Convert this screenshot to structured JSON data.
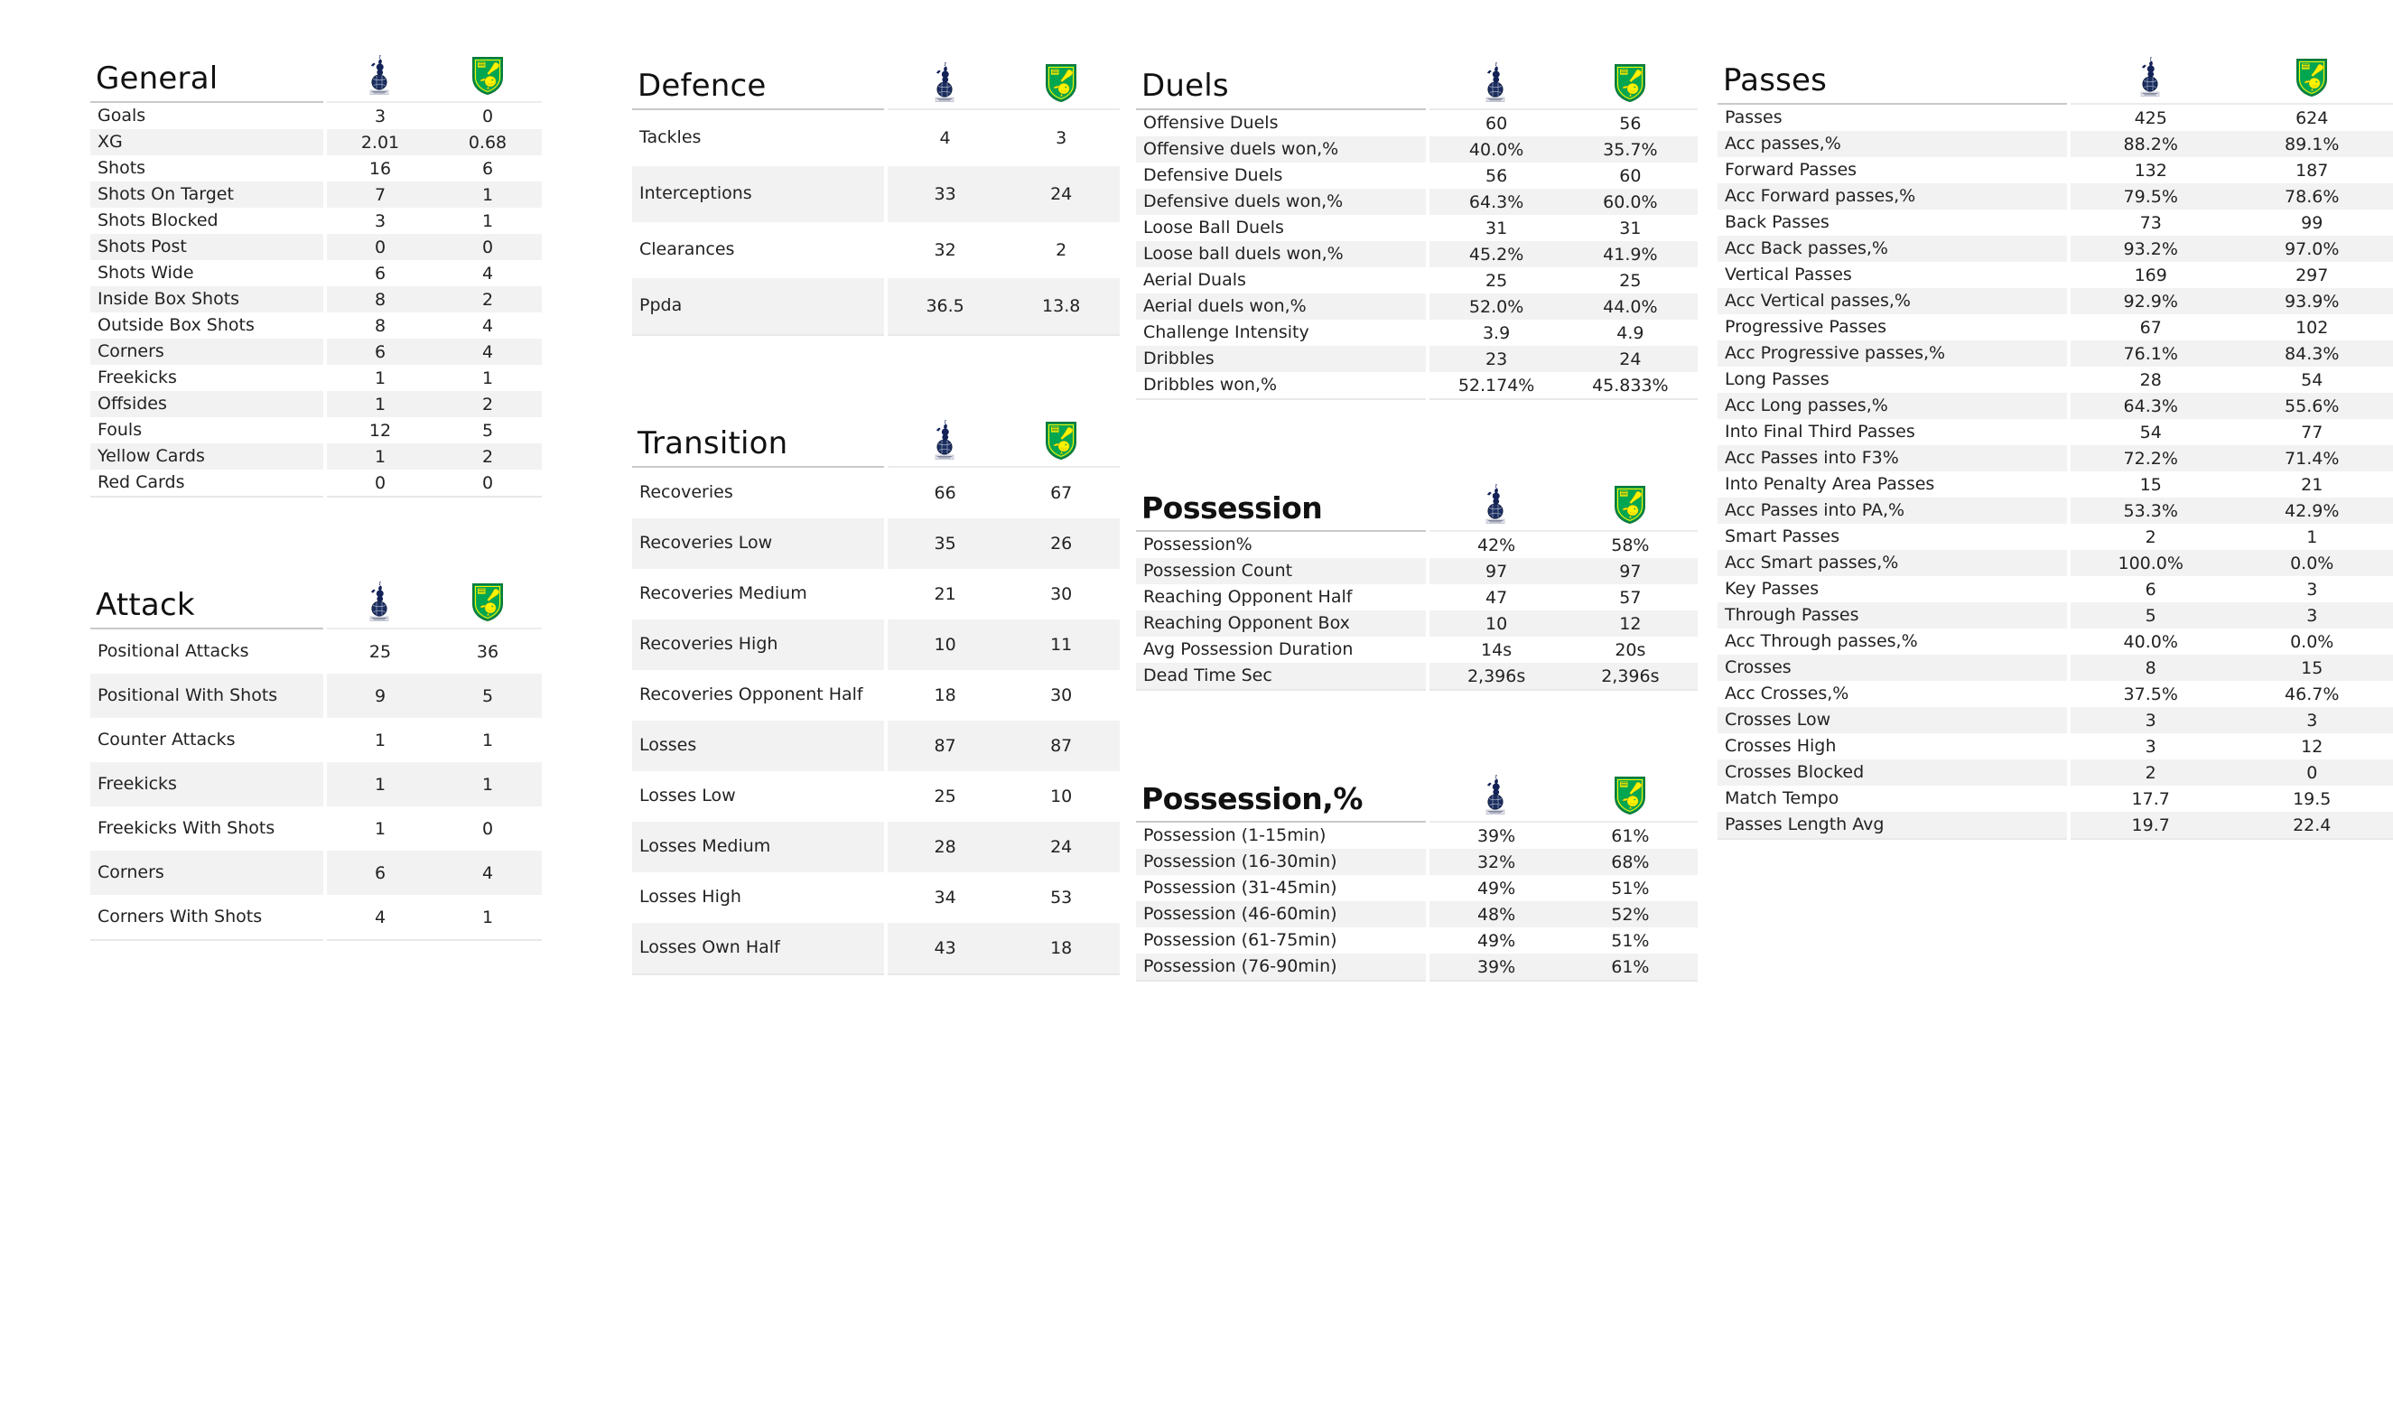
{
  "teams": {
    "home": {
      "name": "Tottenham Hotspur",
      "logo": "tottenham-crest-icon",
      "colors": {
        "primary": "#132257",
        "secondary": "#ffffff"
      }
    },
    "away": {
      "name": "Norwich City",
      "logo": "norwich-city-crest-icon",
      "colors": {
        "primary": "#00a650",
        "secondary": "#fff200"
      }
    }
  },
  "sections": [
    {
      "id": "general",
      "title": "General",
      "title_style": "regular",
      "row_height": "h-sm",
      "rows": [
        {
          "label": "Goals",
          "home": "3",
          "away": "0"
        },
        {
          "label": "XG",
          "home": "2.01",
          "away": "0.68"
        },
        {
          "label": "Shots",
          "home": "16",
          "away": "6"
        },
        {
          "label": "Shots On Target",
          "home": "7",
          "away": "1"
        },
        {
          "label": "Shots Blocked",
          "home": "3",
          "away": "1"
        },
        {
          "label": "Shots Post",
          "home": "0",
          "away": "0"
        },
        {
          "label": "Shots Wide",
          "home": "6",
          "away": "4"
        },
        {
          "label": "Inside Box Shots",
          "home": "8",
          "away": "2"
        },
        {
          "label": "Outside Box Shots",
          "home": "8",
          "away": "4"
        },
        {
          "label": "Corners",
          "home": "6",
          "away": "4"
        },
        {
          "label": "Freekicks",
          "home": "1",
          "away": "1"
        },
        {
          "label": "Offsides",
          "home": "1",
          "away": "2"
        },
        {
          "label": "Fouls",
          "home": "12",
          "away": "5"
        },
        {
          "label": "Yellow Cards",
          "home": "1",
          "away": "2"
        },
        {
          "label": "Red Cards",
          "home": "0",
          "away": "0"
        }
      ]
    },
    {
      "id": "attack",
      "title": "Attack",
      "title_style": "regular",
      "row_height": "h-md",
      "rows": [
        {
          "label": "Positional Attacks",
          "home": "25",
          "away": "36"
        },
        {
          "label": "Positional With Shots",
          "home": "9",
          "away": "5"
        },
        {
          "label": "Counter Attacks",
          "home": "1",
          "away": "1"
        },
        {
          "label": "Freekicks",
          "home": "1",
          "away": "1"
        },
        {
          "label": "Freekicks With Shots",
          "home": "1",
          "away": "0"
        },
        {
          "label": "Corners",
          "home": "6",
          "away": "4"
        },
        {
          "label": "Corners With Shots",
          "home": "4",
          "away": "1"
        }
      ]
    },
    {
      "id": "defence",
      "title": "Defence",
      "title_style": "regular",
      "row_height": "h-xl",
      "rows": [
        {
          "label": "Tackles",
          "home": "4",
          "away": "3"
        },
        {
          "label": "Interceptions",
          "home": "33",
          "away": "24"
        },
        {
          "label": "Clearances",
          "home": "32",
          "away": "2"
        },
        {
          "label": "Ppda",
          "home": "36.5",
          "away": "13.8"
        }
      ]
    },
    {
      "id": "transition",
      "title": "Transition",
      "title_style": "regular",
      "row_height": "h-lg",
      "rows": [
        {
          "label": "Recoveries",
          "home": "66",
          "away": "67"
        },
        {
          "label": "Recoveries Low",
          "home": "35",
          "away": "26"
        },
        {
          "label": "Recoveries Medium",
          "home": "21",
          "away": "30"
        },
        {
          "label": "Recoveries High",
          "home": "10",
          "away": "11"
        },
        {
          "label": "Recoveries Opponent Half",
          "home": "18",
          "away": "30"
        },
        {
          "label": "Losses",
          "home": "87",
          "away": "87"
        },
        {
          "label": "Losses Low",
          "home": "25",
          "away": "10"
        },
        {
          "label": "Losses Medium",
          "home": "28",
          "away": "24"
        },
        {
          "label": "Losses High",
          "home": "34",
          "away": "53"
        },
        {
          "label": "Losses Own Half",
          "home": "43",
          "away": "18"
        }
      ]
    },
    {
      "id": "duels",
      "title": "Duels",
      "title_style": "regular",
      "row_height": "h-sm",
      "rows": [
        {
          "label": "Offensive Duels",
          "home": "60",
          "away": "56"
        },
        {
          "label": "Offensive duels won,%",
          "home": "40.0%",
          "away": "35.7%"
        },
        {
          "label": "Defensive Duels",
          "home": "56",
          "away": "60"
        },
        {
          "label": "Defensive duels won,%",
          "home": "64.3%",
          "away": "60.0%"
        },
        {
          "label": "Loose Ball Duels",
          "home": "31",
          "away": "31"
        },
        {
          "label": "Loose ball duels won,%",
          "home": "45.2%",
          "away": "41.9%"
        },
        {
          "label": "Aerial Duals",
          "home": "25",
          "away": "25"
        },
        {
          "label": "Aerial duels won,%",
          "home": "52.0%",
          "away": "44.0%"
        },
        {
          "label": "Challenge Intensity",
          "home": "3.9",
          "away": "4.9"
        },
        {
          "label": "Dribbles",
          "home": "23",
          "away": "24"
        },
        {
          "label": "Dribbles won,%",
          "home": "52.174%",
          "away": "45.833%"
        }
      ]
    },
    {
      "id": "possession",
      "title": "Possession",
      "title_style": "bold",
      "row_height": "h-sm",
      "rows": [
        {
          "label": "Possession%",
          "home": "42%",
          "away": "58%"
        },
        {
          "label": "Possession Count",
          "home": "97",
          "away": "97"
        },
        {
          "label": "Reaching Opponent Half",
          "home": "47",
          "away": "57"
        },
        {
          "label": "Reaching Opponent Box",
          "home": "10",
          "away": "12"
        },
        {
          "label": "Avg Possession Duration",
          "home": "14s",
          "away": "20s"
        },
        {
          "label": "Dead Time Sec",
          "home": "2,396s",
          "away": "2,396s"
        }
      ]
    },
    {
      "id": "possession-pct",
      "title": "Possession,%",
      "title_style": "bold",
      "row_height": "h-sm",
      "rows": [
        {
          "label": "Possession (1-15min)",
          "home": "39%",
          "away": "61%"
        },
        {
          "label": "Possession (16-30min)",
          "home": "32%",
          "away": "68%"
        },
        {
          "label": "Possession (31-45min)",
          "home": "49%",
          "away": "51%"
        },
        {
          "label": "Possession (46-60min)",
          "home": "48%",
          "away": "52%"
        },
        {
          "label": "Possession (61-75min)",
          "home": "49%",
          "away": "51%"
        },
        {
          "label": "Possession (76-90min)",
          "home": "39%",
          "away": "61%"
        }
      ]
    },
    {
      "id": "passes",
      "title": "Passes",
      "title_style": "regular",
      "row_height": "h-sm",
      "rows": [
        {
          "label": "Passes",
          "home": "425",
          "away": "624"
        },
        {
          "label": "Acc passes,%",
          "home": "88.2%",
          "away": "89.1%"
        },
        {
          "label": "Forward Passes",
          "home": "132",
          "away": "187"
        },
        {
          "label": "Acc Forward passes,%",
          "home": "79.5%",
          "away": "78.6%"
        },
        {
          "label": "Back Passes",
          "home": "73",
          "away": "99"
        },
        {
          "label": "Acc Back passes,%",
          "home": "93.2%",
          "away": "97.0%"
        },
        {
          "label": "Vertical Passes",
          "home": "169",
          "away": "297"
        },
        {
          "label": "Acc Vertical passes,%",
          "home": "92.9%",
          "away": "93.9%"
        },
        {
          "label": "Progressive Passes",
          "home": "67",
          "away": "102"
        },
        {
          "label": "Acc Progressive passes,%",
          "home": "76.1%",
          "away": "84.3%"
        },
        {
          "label": "Long Passes",
          "home": "28",
          "away": "54"
        },
        {
          "label": "Acc Long passes,%",
          "home": "64.3%",
          "away": "55.6%"
        },
        {
          "label": "Into Final Third Passes",
          "home": "54",
          "away": "77"
        },
        {
          "label": "Acc Passes into F3%",
          "home": "72.2%",
          "away": "71.4%"
        },
        {
          "label": "Into Penalty Area Passes",
          "home": "15",
          "away": "21"
        },
        {
          "label": "Acc Passes into PA,%",
          "home": "53.3%",
          "away": "42.9%"
        },
        {
          "label": "Smart Passes",
          "home": "2",
          "away": "1"
        },
        {
          "label": "Acc Smart passes,%",
          "home": "100.0%",
          "away": "0.0%"
        },
        {
          "label": "Key Passes",
          "home": "6",
          "away": "3"
        },
        {
          "label": "Through Passes",
          "home": "5",
          "away": "3"
        },
        {
          "label": "Acc Through passes,%",
          "home": "40.0%",
          "away": "0.0%"
        },
        {
          "label": "Crosses",
          "home": "8",
          "away": "15"
        },
        {
          "label": "Acc Crosses,%",
          "home": "37.5%",
          "away": "46.7%"
        },
        {
          "label": "Crosses Low",
          "home": "3",
          "away": "3"
        },
        {
          "label": "Crosses High",
          "home": "3",
          "away": "12"
        },
        {
          "label": "Crosses Blocked",
          "home": "2",
          "away": "0"
        },
        {
          "label": "Match Tempo",
          "home": "17.7",
          "away": "19.5"
        },
        {
          "label": "Passes Length Avg",
          "home": "19.7",
          "away": "22.4"
        }
      ]
    }
  ],
  "layout": {
    "columns": [
      {
        "sections": [
          "general",
          "attack"
        ]
      },
      {
        "sections": [
          "defence",
          "transition"
        ]
      },
      {
        "sections": [
          "duels",
          "possession",
          "possession-pct"
        ]
      },
      {
        "sections": [
          "passes"
        ]
      }
    ]
  }
}
